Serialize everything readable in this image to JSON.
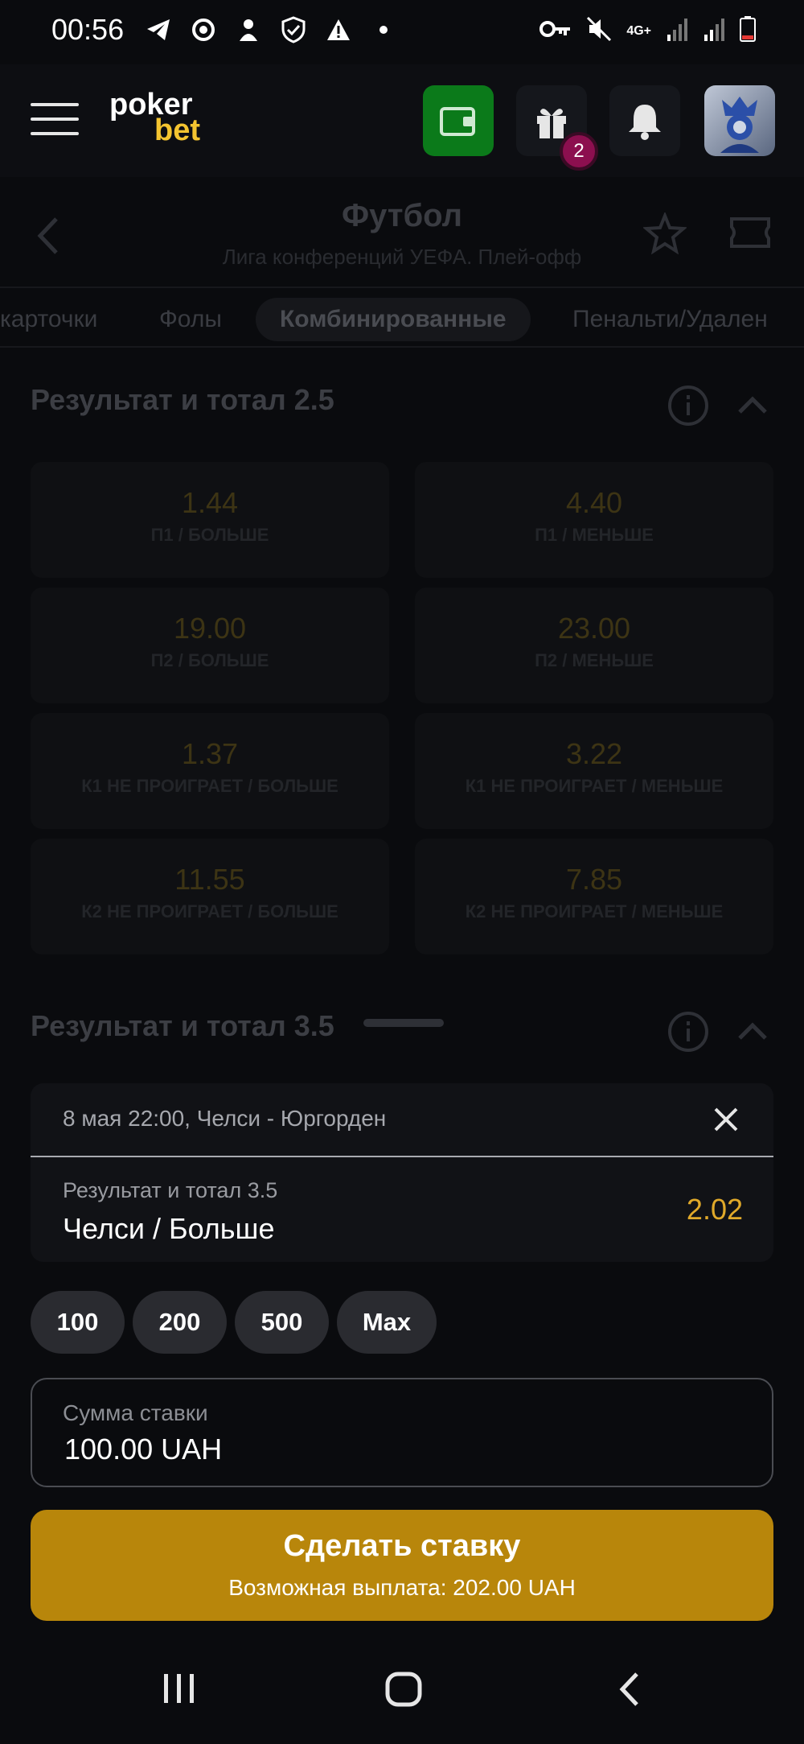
{
  "status_bar": {
    "time": "00:56",
    "network": "4G+"
  },
  "header": {
    "logo_line1": "poker",
    "logo_line2": "bet",
    "gift_badge": "2"
  },
  "event": {
    "sport": "Футбол",
    "league": "Лига конференций УЕФА. Плей-офф"
  },
  "tabs": [
    "карточки",
    "Фолы",
    "Комбинированные",
    "Пенальти/Удален"
  ],
  "markets": [
    {
      "title": "Результат и тотал 2.5",
      "odds": [
        {
          "value": "1.44",
          "label": "П1 / БОЛЬШЕ"
        },
        {
          "value": "4.40",
          "label": "П1 / МЕНЬШЕ"
        },
        {
          "value": "19.00",
          "label": "П2 / БОЛЬШЕ"
        },
        {
          "value": "23.00",
          "label": "П2 / МЕНЬШЕ"
        },
        {
          "value": "1.37",
          "label": "К1 НЕ ПРОИГРАЕТ / БОЛЬШЕ"
        },
        {
          "value": "3.22",
          "label": "К1 НЕ ПРОИГРАЕТ / МЕНЬШЕ"
        },
        {
          "value": "11.55",
          "label": "К2 НЕ ПРОИГРАЕТ / БОЛЬШЕ"
        },
        {
          "value": "7.85",
          "label": "К2 НЕ ПРОИГРАЕТ / МЕНЬШЕ"
        }
      ]
    },
    {
      "title": "Результат и тотал 3.5"
    }
  ],
  "bet_slip": {
    "event": "8 мая 22:00, Челси - Юргорден",
    "market": "Результат и тотал 3.5",
    "pick": "Челси / Больше",
    "odd": "2.02",
    "quick_amounts": [
      "100",
      "200",
      "500",
      "Max"
    ],
    "stake_label": "Сумма ставки",
    "stake_value": "100.00 UAH",
    "place_bet": "Сделать ставку",
    "payout": "Возможная выплата: 202.00 UAH"
  },
  "colors": {
    "accent": "#b8860b",
    "odd": "#e0a92a",
    "wallet": "#0b7a1a",
    "badge": "#8c0f4f"
  }
}
